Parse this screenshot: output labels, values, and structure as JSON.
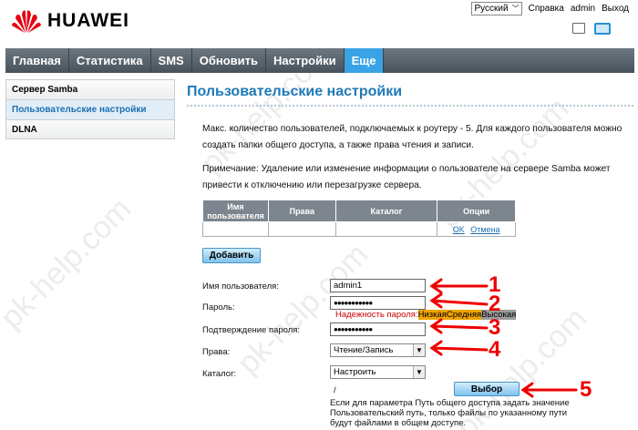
{
  "header": {
    "brand": "HUAWEI",
    "language": "Русский",
    "help": "Справка",
    "user": "admin",
    "logout": "Выход"
  },
  "nav": [
    "Главная",
    "Статистика",
    "SMS",
    "Обновить",
    "Настройки",
    "Еще"
  ],
  "sidebar": [
    "Сервер Samba",
    "Пользовательские настройки",
    "DLNA"
  ],
  "main": {
    "title": "Пользовательские настройки",
    "info": "Макс. количество пользователей, подключаемых к роутеру - 5. Для каждого пользователя можно создать папки общего доступа, а также права чтения и записи.",
    "note": "Примечание: Удаление или изменение информации о пользователе на сервере Samba может привести к отключению или перезагрузке сервера.",
    "table": {
      "headers": [
        "Имя пользователя",
        "Права",
        "Каталог",
        "Опции"
      ],
      "row_ok": "OK",
      "row_cancel": "Отмена"
    },
    "add_button": "Добавить",
    "form": {
      "username_label": "Имя пользователя:",
      "username_value": "admin1",
      "password_label": "Пароль:",
      "password_value": "●●●●●●●●●●●",
      "strength_label": "Надежность пароля:",
      "strength_low": "Низкая",
      "strength_mid": "Средняя",
      "strength_high": "Высокая",
      "confirm_label": "Подтверждение пароля:",
      "confirm_value": "●●●●●●●●●●●",
      "rights_label": "Права:",
      "rights_value": "Чтение/Запись",
      "catalog_label": "Каталог:",
      "catalog_value": "Настроить",
      "path_value": "/",
      "choose_button": "Выбор",
      "hint": "Если для параметра Путь общего доступа задать значение Пользовательский путь, только файлы по указанному пути будут файлами в общем доступе."
    },
    "annotations": [
      "1",
      "2",
      "3",
      "4",
      "5"
    ]
  },
  "watermark": "pk-help.com",
  "colors": {
    "accent": "#3aa3e6",
    "title": "#1f7ab8",
    "annotation": "#e00000"
  }
}
